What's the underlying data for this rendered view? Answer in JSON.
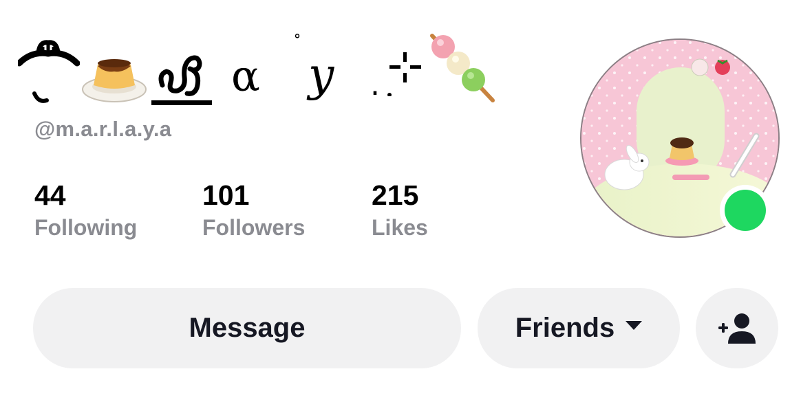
{
  "profile": {
    "display_name": {
      "hat_glyph": "ꕤ",
      "alpha": "α",
      "ring": "˚",
      "y": "y",
      "dot": ".",
      "icons": [
        "lao-hat-glyph-icon",
        "flan-icon",
        "script-glyph-icon",
        "sparkle-icon",
        "dango-icon"
      ]
    },
    "username": "@m.a.r.l.a.y.a"
  },
  "stats": [
    {
      "count": "44",
      "label": "Following"
    },
    {
      "count": "101",
      "label": "Followers"
    },
    {
      "count": "215",
      "label": "Likes"
    }
  ],
  "avatar": {
    "icon": "avatar-image",
    "online": true,
    "online_color": "#1ed760"
  },
  "buttons": {
    "message": "Message",
    "friends": "Friends",
    "add_friend_icon": "add-user-icon"
  },
  "colors": {
    "muted_text": "#8a8b91",
    "button_bg": "#f1f1f2",
    "text": "#161823"
  }
}
